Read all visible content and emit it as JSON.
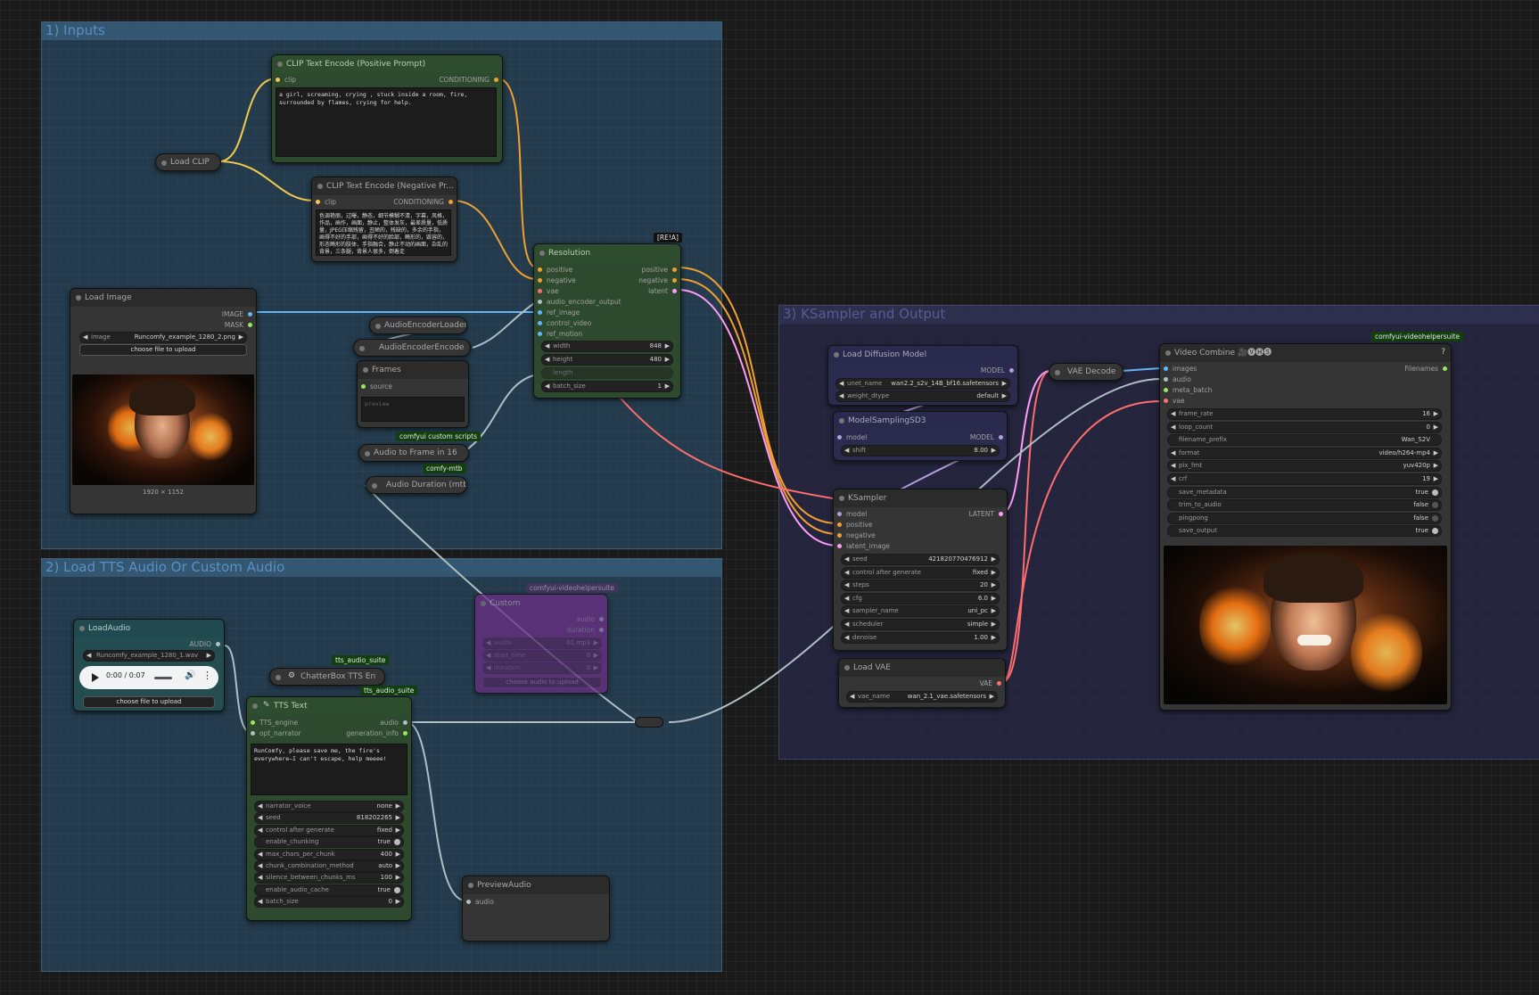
{
  "groups": {
    "inputs": "1) Inputs",
    "tts": "2) Load TTS Audio Or Custom Audio",
    "ksampler": "3) KSampler and Output"
  },
  "colors": {
    "clip": "#f2c94c",
    "conditioning": "#f0a030",
    "image": "#64b5f6",
    "audio": "#b0bec5",
    "latent": "#ff9cf9",
    "model": "#b39ddb",
    "vae": "#ff6e6e",
    "int": "#9be564"
  },
  "clip_pos": {
    "title": "CLIP Text Encode (Positive Prompt)",
    "in_clip": "clip",
    "out": "CONDITIONING",
    "text": "a girl, screaming, crying , stuck inside a room, fire, surrounded by flames, crying for help."
  },
  "load_clip": {
    "title": "Load CLIP"
  },
  "clip_neg": {
    "title": "CLIP Text Encode (Negative Pr...",
    "in_clip": "clip",
    "out": "CONDITIONING",
    "text": "色调艳丽，过曝，静态，细节模糊不清，字幕，风格，作品，画作，画面，静止，整体发灰，最差质量，低质量，JPEG压缩残留，丑陋的，残缺的，多余的手指，画得不好的手部，画得不好的脸部，畸形的，毁容的，形态畸形的肢体，手指融合，静止不动的画面，杂乱的背景，三条腿，背景人很多，倒着走"
  },
  "resolution": {
    "badge": "[RE!A]",
    "title": "Resolution",
    "inputs": [
      "positive",
      "negative",
      "vae",
      "audio_encoder_output",
      "ref_image",
      "control_video",
      "ref_motion"
    ],
    "outputs": [
      "positive",
      "negative",
      "latent"
    ],
    "widgets": [
      {
        "label": "width",
        "value": "848"
      },
      {
        "label": "height",
        "value": "480"
      },
      {
        "label": "length",
        "value": ""
      },
      {
        "label": "batch_size",
        "value": "1"
      }
    ]
  },
  "load_image": {
    "title": "Load Image",
    "out_image": "IMAGE",
    "out_mask": "MASK",
    "image_label": "image",
    "image_value": "Runcomfy_example_1280_2.png",
    "upload": "choose file to upload",
    "dims": "1920 × 1152"
  },
  "audio_encoder_loader": {
    "title": "AudioEncoderLoader"
  },
  "audio_encoder_encode": {
    "title": "AudioEncoderEncode"
  },
  "frames": {
    "title": "Frames",
    "in_source": "source",
    "preview": "preview"
  },
  "audio_to_frame": {
    "badge": "comfyui custom scripts",
    "title": "Audio to Frame in 16"
  },
  "audio_duration": {
    "badge": "comfy-mtb",
    "title": "Audio Duration (mtb)"
  },
  "load_audio": {
    "title": "LoadAudio",
    "out": "AUDIO",
    "file": "Runcomfy_example_1280_1.wav",
    "time": "0:00 / 0:07",
    "upload": "choose file to upload"
  },
  "chatterbox": {
    "badge": "tts_audio_suite",
    "title": "ChatterBox TTS En"
  },
  "tts_text": {
    "badge": "tts_audio_suite",
    "title": "TTS Text",
    "in_engine": "TTS_engine",
    "in_narrator": "opt_narrator",
    "out_audio": "audio",
    "out_info": "generation_info",
    "text": "RunComfy, please save me, the fire's everywhere—I can't escape, help meeee!",
    "widgets": [
      {
        "label": "narrator_voice",
        "value": "none",
        "type": "combo"
      },
      {
        "label": "seed",
        "value": "818202265",
        "type": "num"
      },
      {
        "label": "control after generate",
        "value": "fixed",
        "type": "combo"
      },
      {
        "label": "enable_chunking",
        "value": "true",
        "type": "toggle"
      },
      {
        "label": "max_chars_per_chunk",
        "value": "400",
        "type": "num"
      },
      {
        "label": "chunk_combination_method",
        "value": "auto",
        "type": "combo"
      },
      {
        "label": "silence_between_chunks_ms",
        "value": "100",
        "type": "num"
      },
      {
        "label": "enable_audio_cache",
        "value": "true",
        "type": "toggle"
      },
      {
        "label": "batch_size",
        "value": "0",
        "type": "num"
      }
    ]
  },
  "custom_audio": {
    "badge": "comfyui-videohelpersuite",
    "title": "Custom",
    "out_audio": "audio",
    "out_duration": "duration",
    "widgets": [
      {
        "label": "audio",
        "value": "01.mp3"
      },
      {
        "label": "start_time",
        "value": "0"
      },
      {
        "label": "duration",
        "value": "0"
      }
    ],
    "upload": "choose audio to upload"
  },
  "preview_audio": {
    "title": "PreviewAudio",
    "in_audio": "audio"
  },
  "load_diffusion": {
    "title": "Load Diffusion Model",
    "out": "MODEL",
    "widgets": [
      {
        "label": "unet_name",
        "value": "wan2.2_s2v_14B_bf16.safetensors"
      },
      {
        "label": "weight_dtype",
        "value": "default"
      }
    ]
  },
  "model_sampling": {
    "title": "ModelSamplingSD3",
    "in_model": "model",
    "out": "MODEL",
    "widgets": [
      {
        "label": "shift",
        "value": "8.00"
      }
    ]
  },
  "ksampler": {
    "title": "KSampler",
    "out": "LATENT",
    "inputs": [
      "model",
      "positive",
      "negative",
      "latent_image"
    ],
    "widgets": [
      {
        "label": "seed",
        "value": "421820770476912"
      },
      {
        "label": "control after generate",
        "value": "fixed"
      },
      {
        "label": "steps",
        "value": "20"
      },
      {
        "label": "cfg",
        "value": "6.0"
      },
      {
        "label": "sampler_name",
        "value": "uni_pc"
      },
      {
        "label": "scheduler",
        "value": "simple"
      },
      {
        "label": "denoise",
        "value": "1.00"
      }
    ]
  },
  "load_vae": {
    "title": "Load VAE",
    "out": "VAE",
    "widgets": [
      {
        "label": "vae_name",
        "value": "wan_2.1_vae.safetensors"
      }
    ]
  },
  "vae_decode": {
    "title": "VAE Decode"
  },
  "video_combine": {
    "badge": "comfyui-videohelpersuite",
    "title": "Video Combine 🎥🅥🅗🅢",
    "help": "?",
    "inputs": [
      "images",
      "audio",
      "meta_batch",
      "vae"
    ],
    "out": "Filenames",
    "widgets": [
      {
        "label": "frame_rate",
        "value": "16",
        "type": "num"
      },
      {
        "label": "loop_count",
        "value": "0",
        "type": "num"
      },
      {
        "label": "filename_prefix",
        "value": "Wan_S2V",
        "type": "text"
      },
      {
        "label": "format",
        "value": "video/h264-mp4",
        "type": "combo"
      },
      {
        "label": "pix_fmt",
        "value": "yuv420p",
        "type": "combo"
      },
      {
        "label": "crf",
        "value": "19",
        "type": "num"
      },
      {
        "label": "save_metadata",
        "value": "true",
        "type": "toggle"
      },
      {
        "label": "trim_to_audio",
        "value": "false",
        "type": "toggleoff"
      },
      {
        "label": "pingpong",
        "value": "false",
        "type": "toggleoff"
      },
      {
        "label": "save_output",
        "value": "true",
        "type": "toggle"
      }
    ]
  }
}
